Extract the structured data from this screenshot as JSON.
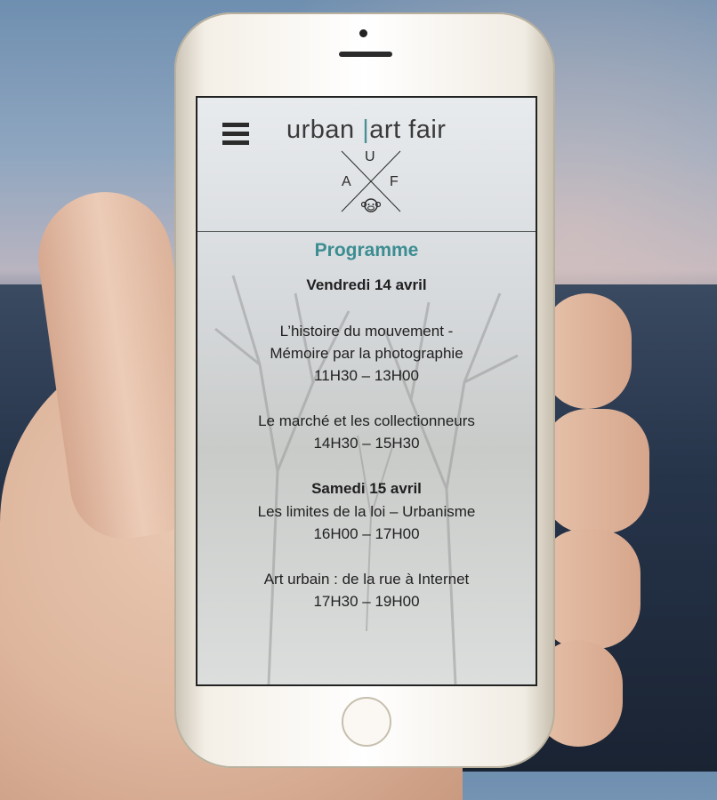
{
  "brand": {
    "part1": "urban ",
    "separator": "|",
    "part2": "art fair"
  },
  "logo": {
    "letters": [
      "U",
      "A",
      "F"
    ],
    "icon": "monkey-head-icon"
  },
  "menu": {
    "icon": "hamburger-menu-icon"
  },
  "programme": {
    "title": "Programme",
    "days": [
      {
        "label": "Vendredi 14 avril",
        "events": [
          {
            "lines": [
              "L’histoire du mouvement -",
              "Mémoire par la photographie"
            ],
            "time": "11H30 – 13H00"
          },
          {
            "lines": [
              "Le marché et les collectionneurs"
            ],
            "time": "14H30 – 15H30"
          }
        ]
      },
      {
        "label": "Samedi 15 avril",
        "events": [
          {
            "lines": [
              "Les limites de la loi – Urbanisme"
            ],
            "time": "16H00 – 17H00"
          },
          {
            "lines": [
              "Art urbain : de la rue à Internet"
            ],
            "time": "17H30 – 19H00"
          }
        ]
      }
    ]
  },
  "colors": {
    "accent": "#3c8d92",
    "text": "#1f1f1f"
  }
}
